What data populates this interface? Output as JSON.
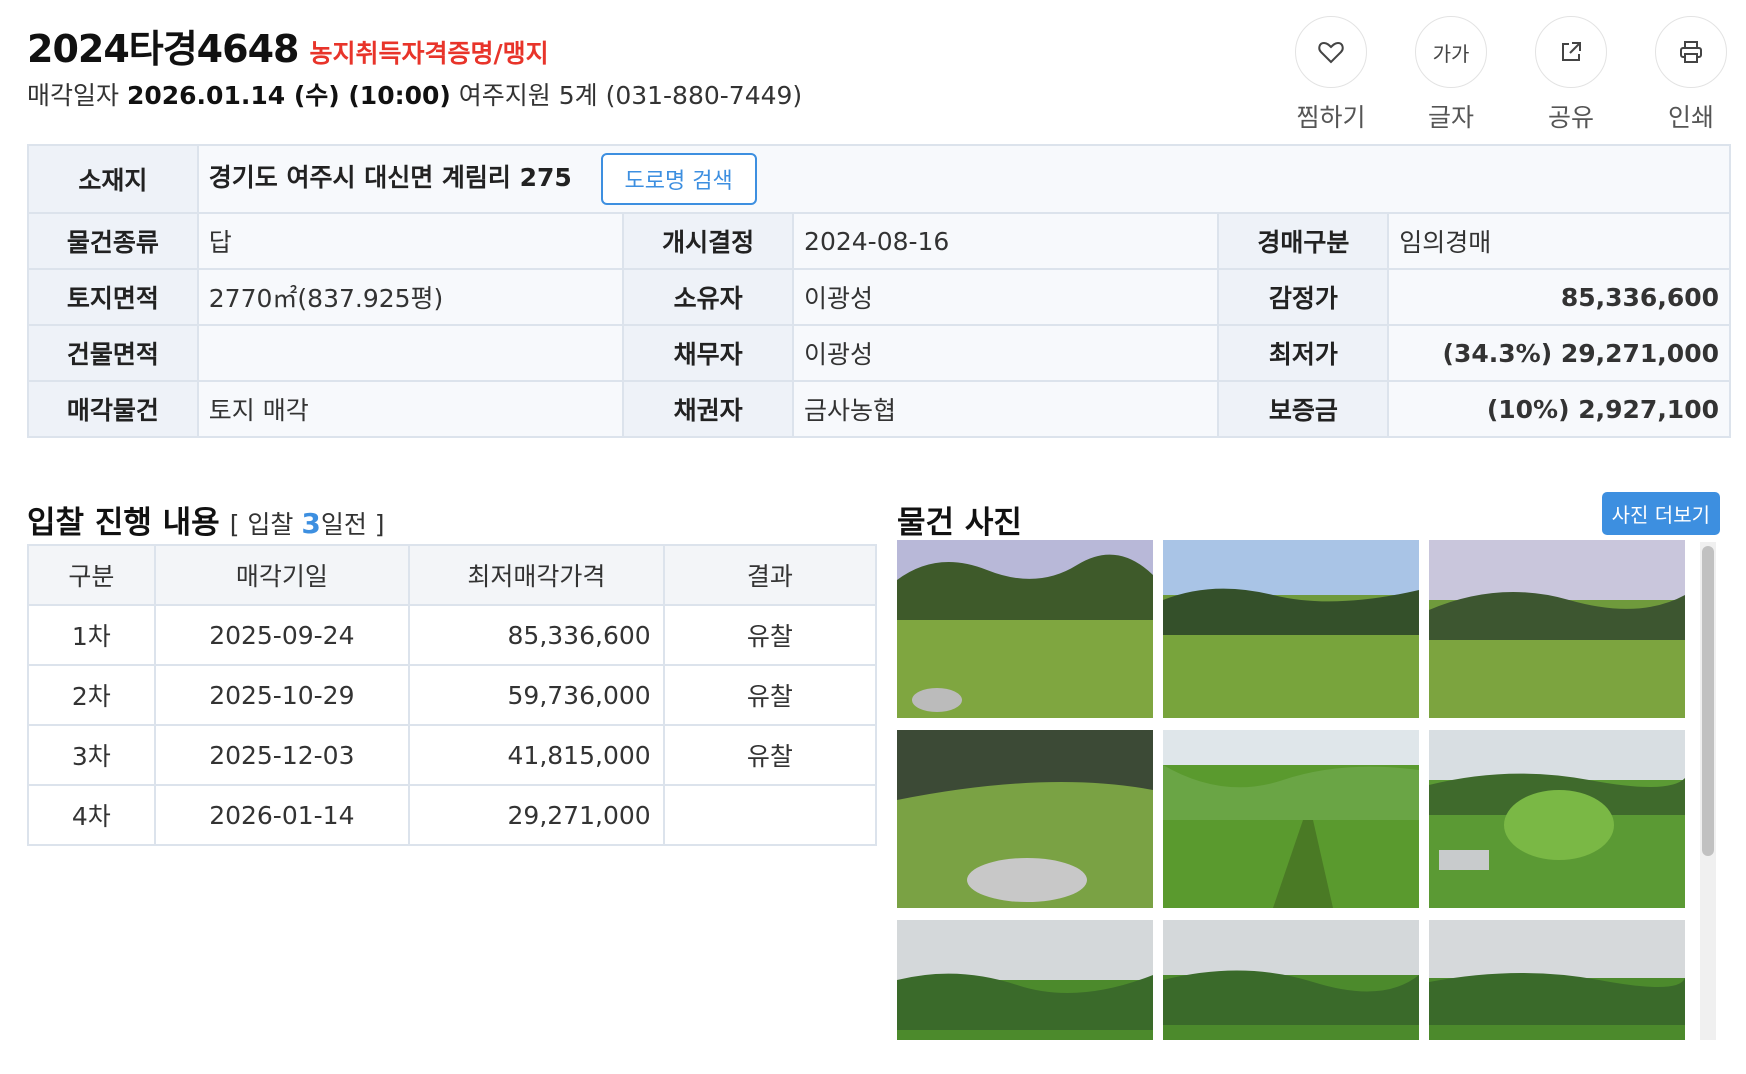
{
  "header": {
    "case_number": "2024타경4648",
    "tag": "농지취득자격증명/맹지",
    "date_label": "매각일자",
    "date_value": "2026.01.14 (수) (10:00)",
    "court": "여주지원 5계 (031-880-7449)"
  },
  "actions": [
    {
      "label": "찜하기",
      "icon": "heart-icon"
    },
    {
      "label": "글자",
      "icon": "font-size-icon",
      "glyph": "가가"
    },
    {
      "label": "공유",
      "icon": "share-icon"
    },
    {
      "label": "인쇄",
      "icon": "print-icon"
    }
  ],
  "info": {
    "address_label": "소재지",
    "address": "경기도 여주시 대신면 계림리 275",
    "road_button": "도로명 검색",
    "rows": [
      [
        "물건종류",
        "답",
        "개시결정",
        "2024-08-16",
        "경매구분",
        "임의경매"
      ],
      [
        "토지면적",
        "2770㎡(837.925평)",
        "소유자",
        "이광성",
        "감정가",
        "85,336,600"
      ],
      [
        "건물면적",
        "",
        "채무자",
        "이광성",
        "최저가",
        "(34.3%) 29,271,000"
      ],
      [
        "매각물건",
        "토지 매각",
        "채권자",
        "금사농협",
        "보증금",
        "(10%) 2,927,100"
      ]
    ]
  },
  "bids": {
    "title": "입찰 진행 내용",
    "remain_prefix": "[ 입찰",
    "remain_days": "3",
    "remain_suffix": "일전 ]",
    "headers": [
      "구분",
      "매각기일",
      "최저매각가격",
      "결과"
    ],
    "rows": [
      [
        "1차",
        "2025-09-24",
        "85,336,600",
        "유찰"
      ],
      [
        "2차",
        "2025-10-29",
        "59,736,000",
        "유찰"
      ],
      [
        "3차",
        "2025-12-03",
        "41,815,000",
        "유찰"
      ],
      [
        "4차",
        "2026-01-14",
        "29,271,000",
        ""
      ]
    ]
  },
  "photos": {
    "title": "물건 사진",
    "more_button": "사진 더보기",
    "count": 9
  },
  "colors": {
    "accent_blue": "#3d8fe0",
    "tag_red": "#e8342a",
    "table_border": "#dce3ec",
    "table_bg": "#f5f8fc"
  }
}
